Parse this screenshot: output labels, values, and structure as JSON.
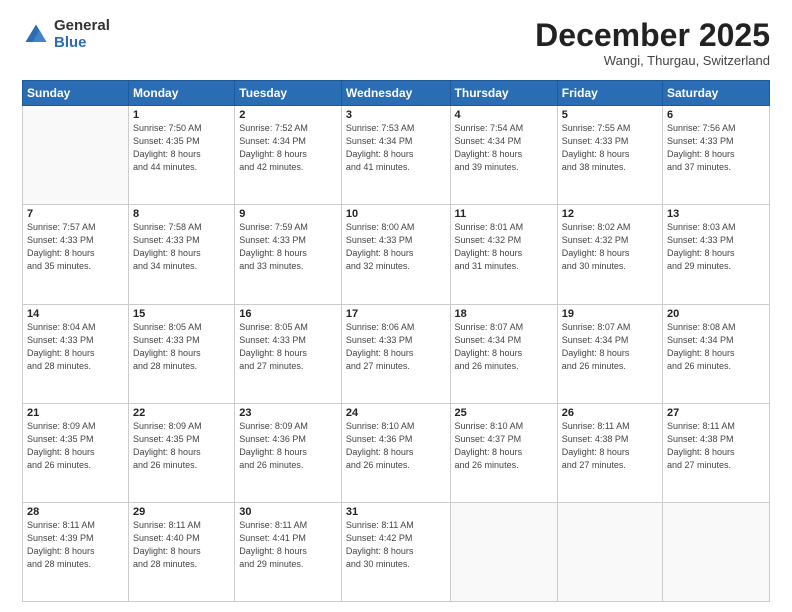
{
  "header": {
    "logo_general": "General",
    "logo_blue": "Blue",
    "month_title": "December 2025",
    "location": "Wangi, Thurgau, Switzerland"
  },
  "days_of_week": [
    "Sunday",
    "Monday",
    "Tuesday",
    "Wednesday",
    "Thursday",
    "Friday",
    "Saturday"
  ],
  "weeks": [
    [
      {
        "day": "",
        "info": ""
      },
      {
        "day": "1",
        "info": "Sunrise: 7:50 AM\nSunset: 4:35 PM\nDaylight: 8 hours\nand 44 minutes."
      },
      {
        "day": "2",
        "info": "Sunrise: 7:52 AM\nSunset: 4:34 PM\nDaylight: 8 hours\nand 42 minutes."
      },
      {
        "day": "3",
        "info": "Sunrise: 7:53 AM\nSunset: 4:34 PM\nDaylight: 8 hours\nand 41 minutes."
      },
      {
        "day": "4",
        "info": "Sunrise: 7:54 AM\nSunset: 4:34 PM\nDaylight: 8 hours\nand 39 minutes."
      },
      {
        "day": "5",
        "info": "Sunrise: 7:55 AM\nSunset: 4:33 PM\nDaylight: 8 hours\nand 38 minutes."
      },
      {
        "day": "6",
        "info": "Sunrise: 7:56 AM\nSunset: 4:33 PM\nDaylight: 8 hours\nand 37 minutes."
      }
    ],
    [
      {
        "day": "7",
        "info": "Sunrise: 7:57 AM\nSunset: 4:33 PM\nDaylight: 8 hours\nand 35 minutes."
      },
      {
        "day": "8",
        "info": "Sunrise: 7:58 AM\nSunset: 4:33 PM\nDaylight: 8 hours\nand 34 minutes."
      },
      {
        "day": "9",
        "info": "Sunrise: 7:59 AM\nSunset: 4:33 PM\nDaylight: 8 hours\nand 33 minutes."
      },
      {
        "day": "10",
        "info": "Sunrise: 8:00 AM\nSunset: 4:33 PM\nDaylight: 8 hours\nand 32 minutes."
      },
      {
        "day": "11",
        "info": "Sunrise: 8:01 AM\nSunset: 4:32 PM\nDaylight: 8 hours\nand 31 minutes."
      },
      {
        "day": "12",
        "info": "Sunrise: 8:02 AM\nSunset: 4:32 PM\nDaylight: 8 hours\nand 30 minutes."
      },
      {
        "day": "13",
        "info": "Sunrise: 8:03 AM\nSunset: 4:33 PM\nDaylight: 8 hours\nand 29 minutes."
      }
    ],
    [
      {
        "day": "14",
        "info": "Sunrise: 8:04 AM\nSunset: 4:33 PM\nDaylight: 8 hours\nand 28 minutes."
      },
      {
        "day": "15",
        "info": "Sunrise: 8:05 AM\nSunset: 4:33 PM\nDaylight: 8 hours\nand 28 minutes."
      },
      {
        "day": "16",
        "info": "Sunrise: 8:05 AM\nSunset: 4:33 PM\nDaylight: 8 hours\nand 27 minutes."
      },
      {
        "day": "17",
        "info": "Sunrise: 8:06 AM\nSunset: 4:33 PM\nDaylight: 8 hours\nand 27 minutes."
      },
      {
        "day": "18",
        "info": "Sunrise: 8:07 AM\nSunset: 4:34 PM\nDaylight: 8 hours\nand 26 minutes."
      },
      {
        "day": "19",
        "info": "Sunrise: 8:07 AM\nSunset: 4:34 PM\nDaylight: 8 hours\nand 26 minutes."
      },
      {
        "day": "20",
        "info": "Sunrise: 8:08 AM\nSunset: 4:34 PM\nDaylight: 8 hours\nand 26 minutes."
      }
    ],
    [
      {
        "day": "21",
        "info": "Sunrise: 8:09 AM\nSunset: 4:35 PM\nDaylight: 8 hours\nand 26 minutes."
      },
      {
        "day": "22",
        "info": "Sunrise: 8:09 AM\nSunset: 4:35 PM\nDaylight: 8 hours\nand 26 minutes."
      },
      {
        "day": "23",
        "info": "Sunrise: 8:09 AM\nSunset: 4:36 PM\nDaylight: 8 hours\nand 26 minutes."
      },
      {
        "day": "24",
        "info": "Sunrise: 8:10 AM\nSunset: 4:36 PM\nDaylight: 8 hours\nand 26 minutes."
      },
      {
        "day": "25",
        "info": "Sunrise: 8:10 AM\nSunset: 4:37 PM\nDaylight: 8 hours\nand 26 minutes."
      },
      {
        "day": "26",
        "info": "Sunrise: 8:11 AM\nSunset: 4:38 PM\nDaylight: 8 hours\nand 27 minutes."
      },
      {
        "day": "27",
        "info": "Sunrise: 8:11 AM\nSunset: 4:38 PM\nDaylight: 8 hours\nand 27 minutes."
      }
    ],
    [
      {
        "day": "28",
        "info": "Sunrise: 8:11 AM\nSunset: 4:39 PM\nDaylight: 8 hours\nand 28 minutes."
      },
      {
        "day": "29",
        "info": "Sunrise: 8:11 AM\nSunset: 4:40 PM\nDaylight: 8 hours\nand 28 minutes."
      },
      {
        "day": "30",
        "info": "Sunrise: 8:11 AM\nSunset: 4:41 PM\nDaylight: 8 hours\nand 29 minutes."
      },
      {
        "day": "31",
        "info": "Sunrise: 8:11 AM\nSunset: 4:42 PM\nDaylight: 8 hours\nand 30 minutes."
      },
      {
        "day": "",
        "info": ""
      },
      {
        "day": "",
        "info": ""
      },
      {
        "day": "",
        "info": ""
      }
    ]
  ]
}
